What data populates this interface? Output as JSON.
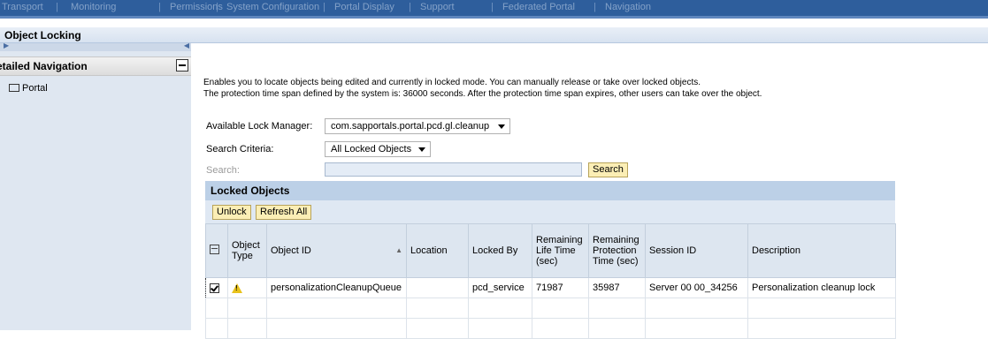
{
  "topnav": {
    "items": [
      "Transport",
      "|",
      "Monitoring",
      "|",
      "Permissions",
      "|",
      "System Configuration",
      "|",
      "Portal Display",
      "|",
      "Support",
      "|",
      "Federated Portal",
      "|",
      "Navigation"
    ]
  },
  "page": {
    "title": "Object Locking"
  },
  "sidebar": {
    "detailed_nav_title": "etailed Navigation",
    "portal_label": "Portal"
  },
  "main": {
    "desc_line1": "Enables you to locate objects being edited and currently in locked mode. You can manually release or take over locked objects.",
    "desc_line2": "The protection time span defined by the system is: 36000 seconds. After the protection time span expires, other users can take over the object.",
    "lock_manager_label": "Available Lock Manager:",
    "lock_manager_value": "com.sapportals.portal.pcd.gl.cleanup",
    "search_criteria_label": "Search Criteria:",
    "search_criteria_value": "All Locked Objects",
    "search_label": "Search:",
    "search_value": "",
    "search_button": "Search"
  },
  "locked_objects": {
    "title": "Locked Objects",
    "unlock_button": "Unlock",
    "refresh_button": "Refresh All",
    "columns": {
      "object_type": "Object Type",
      "object_id": "Object ID",
      "location": "Location",
      "locked_by": "Locked By",
      "remaining_life": "Remaining Life Time (sec)",
      "remaining_protection": "Remaining Protection Time (sec)",
      "session_id": "Session ID",
      "description": "Description"
    },
    "rows": [
      {
        "object_id": "personalizationCleanupQueue",
        "location": "",
        "locked_by": "pcd_service",
        "remaining_life": "71987",
        "remaining_protection": "35987",
        "session_id": "Server 00 00_34256",
        "description": "Personalization cleanup lock"
      }
    ]
  },
  "icons": {
    "warning": "warning-icon",
    "checkbox": "checkbox-checked-icon",
    "folder": "folder-icon",
    "sort": "sort-ascending-icon",
    "select_columns": "select-columns-icon"
  },
  "colors": {
    "topnav_bg": "#2e5e9c",
    "button_bg": "#fbeeb5",
    "tray_header": "#bcd0e7",
    "sidebar_bg": "#dfe7f1"
  }
}
